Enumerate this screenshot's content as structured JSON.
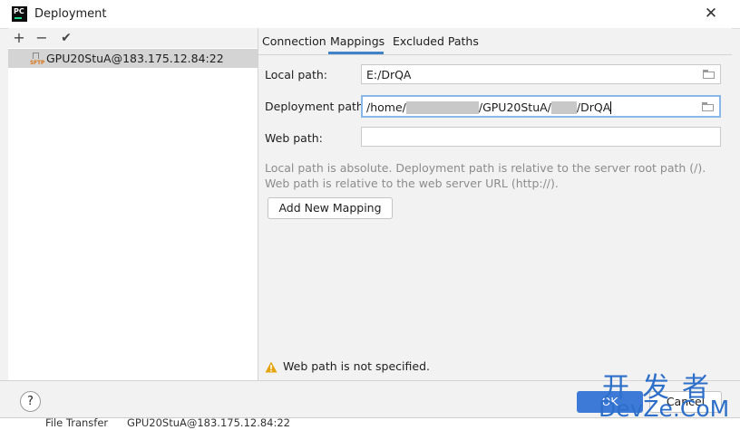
{
  "window": {
    "title": "Deployment",
    "app_icon_text": "PC"
  },
  "toolbar": {
    "add": "+",
    "remove": "−",
    "apply": "✔"
  },
  "servers": [
    {
      "icon_label": "SFTP",
      "name": "GPU20StuA@183.175.12.84:22",
      "selected": true
    }
  ],
  "tabs": [
    {
      "label": "Connection",
      "active": false
    },
    {
      "label": "Mappings",
      "active": true
    },
    {
      "label": "Excluded Paths",
      "active": false
    }
  ],
  "mappings": {
    "local_path": {
      "label": "Local path:",
      "value": "E:/DrQA"
    },
    "deployment_path": {
      "label": "Deployment path:",
      "value_parts": [
        "/home/",
        "/GPU20StuA/",
        "/DrQA"
      ]
    },
    "web_path": {
      "label": "Web path:",
      "value": ""
    },
    "hint_line1": "Local path is absolute. Deployment path is relative to the server root path (/).",
    "hint_line2": "Web path is relative to the web server URL (http://).",
    "add_mapping_label": "Add New Mapping",
    "warning_text": "Web path is not specified."
  },
  "footer": {
    "help_label": "?",
    "ok_label": "OK",
    "cancel_label": "Cancel"
  },
  "background_window": {
    "tool_name": "File Transfer",
    "server": "GPU20StuA@183.175.12.84:22"
  },
  "watermark": {
    "cn": "开发者",
    "en": "DevZe.CoM"
  },
  "colors": {
    "accent": "#4083c9",
    "ok_button": "#3d7ad8",
    "warning": "#e5a50a",
    "sftp": "#d8761b"
  }
}
